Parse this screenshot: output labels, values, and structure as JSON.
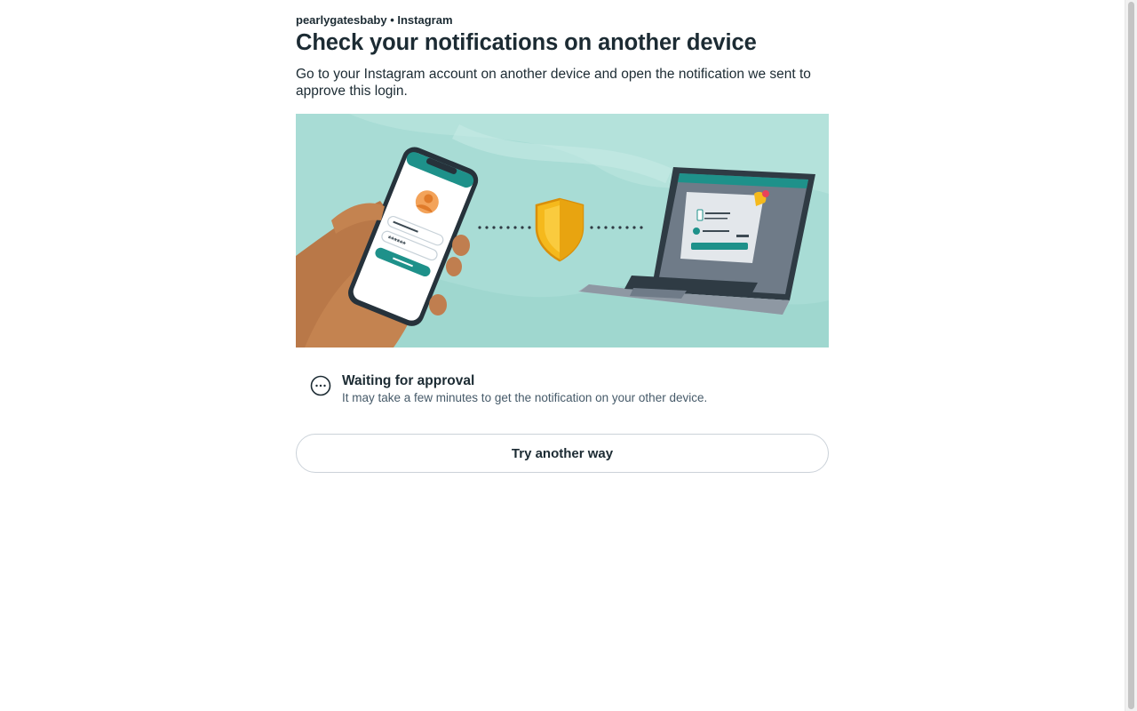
{
  "header": {
    "account_line": "pearlygatesbaby • Instagram",
    "title": "Check your notifications on another device",
    "description": "Go to your Instagram account on another device and open the notification we sent to approve this login."
  },
  "illustration": {
    "phone_password_mask": "******",
    "colors": {
      "background": "#a8dcd5",
      "accent_teal": "#1e918a",
      "shield_gold": "#f5b91c",
      "skin": "#c07e4f",
      "laptop_gray": "#7c8896"
    }
  },
  "status": {
    "icon": "more-horizontal-circle-icon",
    "title": "Waiting for approval",
    "subtitle": "It may take a few minutes to get the notification on your other device."
  },
  "actions": {
    "try_another_way_label": "Try another way"
  }
}
